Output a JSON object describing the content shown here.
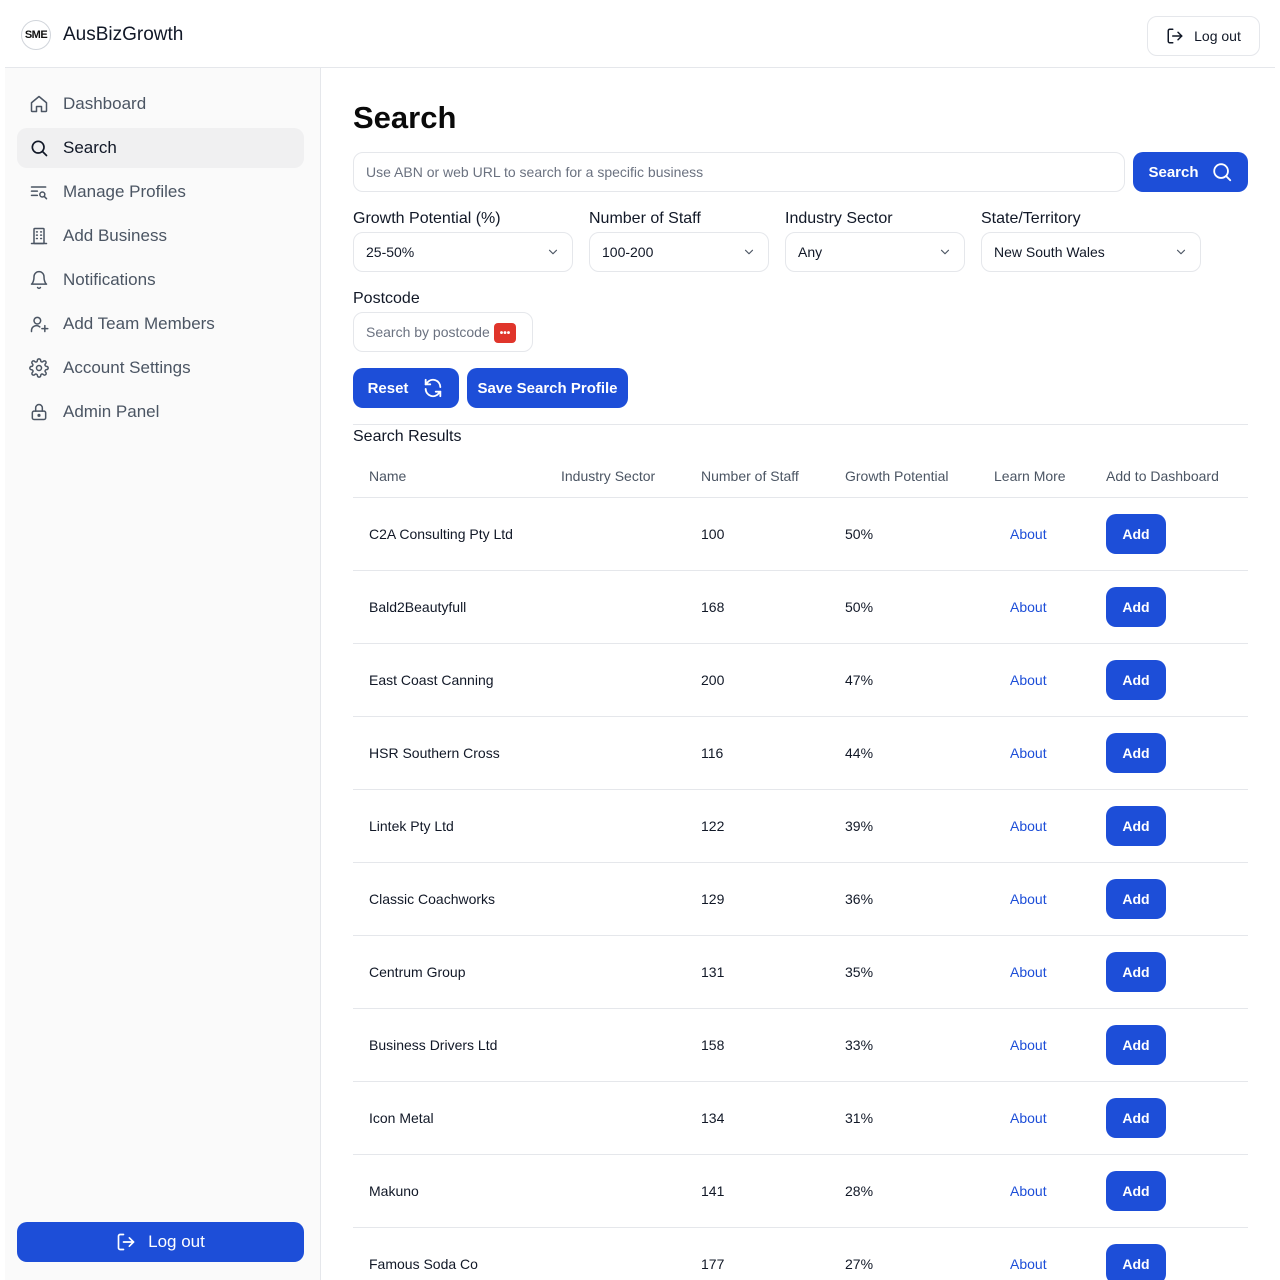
{
  "header": {
    "logo_text": "SME",
    "app_name": "AusBizGrowth",
    "logout_label": "Log out"
  },
  "sidebar": {
    "items": [
      {
        "label": "Dashboard",
        "icon": "home-icon",
        "active": false
      },
      {
        "label": "Search",
        "icon": "search-icon",
        "active": true
      },
      {
        "label": "Manage Profiles",
        "icon": "list-search-icon",
        "active": false
      },
      {
        "label": "Add Business",
        "icon": "building-icon",
        "active": false
      },
      {
        "label": "Notifications",
        "icon": "bell-icon",
        "active": false
      },
      {
        "label": "Add Team Members",
        "icon": "user-plus-icon",
        "active": false
      },
      {
        "label": "Account Settings",
        "icon": "gear-icon",
        "active": false
      },
      {
        "label": "Admin Panel",
        "icon": "lock-icon",
        "active": false
      }
    ],
    "logout_label": "Log out"
  },
  "main": {
    "title": "Search",
    "search": {
      "placeholder": "Use ABN or web URL to search for a specific business",
      "button_label": "Search"
    },
    "filters": {
      "growth": {
        "label": "Growth Potential (%)",
        "value": "25-50%"
      },
      "staff": {
        "label": "Number of Staff",
        "value": "100-200"
      },
      "sector": {
        "label": "Industry Sector",
        "value": "Any"
      },
      "state": {
        "label": "State/Territory",
        "value": "New South Wales"
      }
    },
    "postcode": {
      "label": "Postcode",
      "placeholder": "Search by postcode"
    },
    "reset_label": "Reset",
    "save_profile_label": "Save Search Profile",
    "results_title": "Search Results",
    "columns": [
      "Name",
      "Industry Sector",
      "Number of Staff",
      "Growth Potential",
      "Learn More",
      "Add to Dashboard"
    ],
    "rows": [
      {
        "name": "C2A Consulting Pty Ltd",
        "sector": "",
        "staff": "100",
        "growth": "50%",
        "learn": "About",
        "add": "Add"
      },
      {
        "name": "Bald2Beautyfull",
        "sector": "",
        "staff": "168",
        "growth": "50%",
        "learn": "About",
        "add": "Add"
      },
      {
        "name": "East Coast Canning",
        "sector": "",
        "staff": "200",
        "growth": "47%",
        "learn": "About",
        "add": "Add"
      },
      {
        "name": "HSR Southern Cross",
        "sector": "",
        "staff": "116",
        "growth": "44%",
        "learn": "About",
        "add": "Add"
      },
      {
        "name": "Lintek Pty Ltd",
        "sector": "",
        "staff": "122",
        "growth": "39%",
        "learn": "About",
        "add": "Add"
      },
      {
        "name": "Classic Coachworks",
        "sector": "",
        "staff": "129",
        "growth": "36%",
        "learn": "About",
        "add": "Add"
      },
      {
        "name": "Centrum Group",
        "sector": "",
        "staff": "131",
        "growth": "35%",
        "learn": "About",
        "add": "Add"
      },
      {
        "name": "Business Drivers Ltd",
        "sector": "",
        "staff": "158",
        "growth": "33%",
        "learn": "About",
        "add": "Add"
      },
      {
        "name": "Icon Metal",
        "sector": "",
        "staff": "134",
        "growth": "31%",
        "learn": "About",
        "add": "Add"
      },
      {
        "name": "Makuno",
        "sector": "",
        "staff": "141",
        "growth": "28%",
        "learn": "About",
        "add": "Add"
      },
      {
        "name": "Famous Soda Co",
        "sector": "",
        "staff": "177",
        "growth": "27%",
        "learn": "About",
        "add": "Add"
      }
    ]
  },
  "colors": {
    "primary": "#1d4ed8",
    "border": "#e5e7eb",
    "sidebar_bg": "#fafafa"
  }
}
